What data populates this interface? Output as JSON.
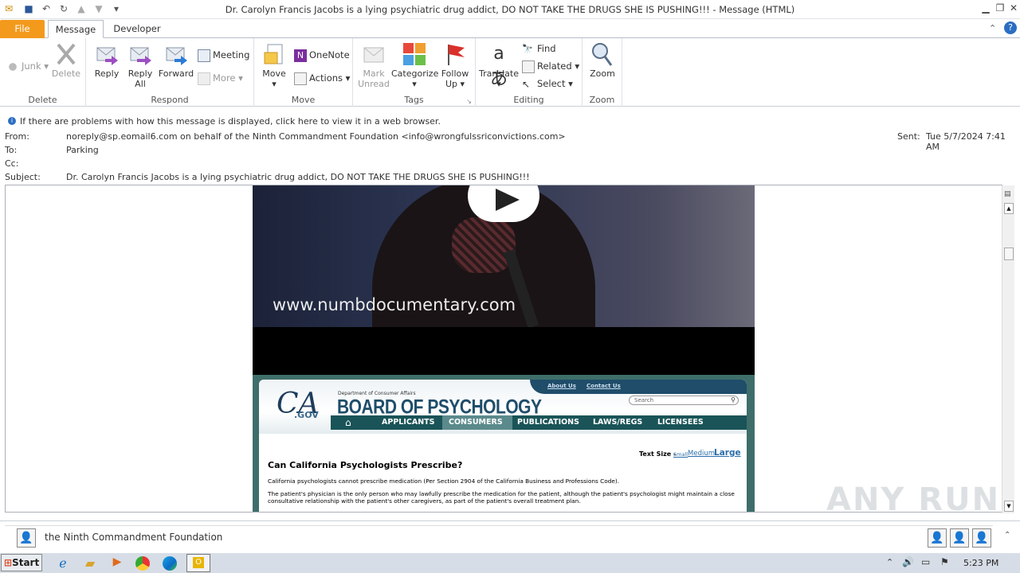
{
  "window": {
    "title": "Dr. Carolyn Francis Jacobs is a lying psychiatric drug addict, DO NOT TAKE THE DRUGS SHE IS PUSHING!!! -  Message (HTML)",
    "controls": {
      "minimize": "▁",
      "restore": "❐",
      "close": "✕"
    }
  },
  "tabs": {
    "file": "File",
    "message": "Message",
    "developer": "Developer"
  },
  "ribbon": {
    "delete_group": {
      "junk": "Junk",
      "delete": "Delete",
      "label": "Delete"
    },
    "respond_group": {
      "reply": "Reply",
      "reply_all_1": "Reply",
      "reply_all_2": "All",
      "forward": "Forward",
      "meeting": "Meeting",
      "more": "More",
      "label": "Respond"
    },
    "move_group": {
      "move": "Move",
      "onenote": "OneNote",
      "actions": "Actions",
      "label": "Move"
    },
    "tags_group": {
      "mark_1": "Mark",
      "mark_2": "Unread",
      "categorize": "Categorize",
      "follow_1": "Follow",
      "follow_2": "Up",
      "label": "Tags"
    },
    "editing_group": {
      "translate": "Translate",
      "find": "Find",
      "related": "Related",
      "select": "Select",
      "label": "Editing"
    },
    "zoom_group": {
      "zoom": "Zoom",
      "label": "Zoom"
    }
  },
  "infobar": {
    "text": "If there are problems with how this message is displayed, click here to view it in a web browser."
  },
  "header": {
    "from_label": "From:",
    "from_value": "noreply@sp.eomail6.com on behalf of the Ninth Commandment Foundation <info@wrongfulssriconvictions.com>",
    "sent_label": "Sent:",
    "sent_value": "Tue 5/7/2024 7:41 AM",
    "to_label": "To:",
    "to_value": "Parking",
    "cc_label": "Cc:",
    "subject_label": "Subject:",
    "subject_value": "Dr. Carolyn Francis Jacobs is a lying psychiatric drug addict, DO NOT TAKE THE DRUGS SHE IS PUSHING!!!"
  },
  "email": {
    "video_url": "www.numbdocumentary.com",
    "site": {
      "top_links": [
        "About Us",
        "Contact Us"
      ],
      "dept": "Department of Consumer Affairs",
      "board": "BOARD OF PSYCHOLOGY",
      "logo_ca": "CA",
      "logo_gov": ".GOV",
      "search_placeholder": "Search",
      "nav": [
        "APPLICANTS",
        "CONSUMERS",
        "PUBLICATIONS",
        "LAWS/REGS",
        "LICENSEES"
      ],
      "text_size_label": "Text Size -",
      "sizes": [
        "Small",
        "Medium",
        "Large"
      ],
      "heading": "Can California Psychologists Prescribe?",
      "p1": "California psychologists cannot prescribe  medication (Per Section 2904 of the California Business and Professions Code).",
      "p2a": "The patient's physician is the only person who may lawfully prescribe the medication for the patient, although the patient's psychologist might maintain a close",
      "p2b": "consultative relationship with the patient's other caregivers, as part of the patient's overall treatment plan."
    }
  },
  "people_pane": {
    "name": "the Ninth Commandment Foundation"
  },
  "taskbar": {
    "start": "Start",
    "time": "5:23 PM"
  },
  "watermark": "ANY RUN"
}
